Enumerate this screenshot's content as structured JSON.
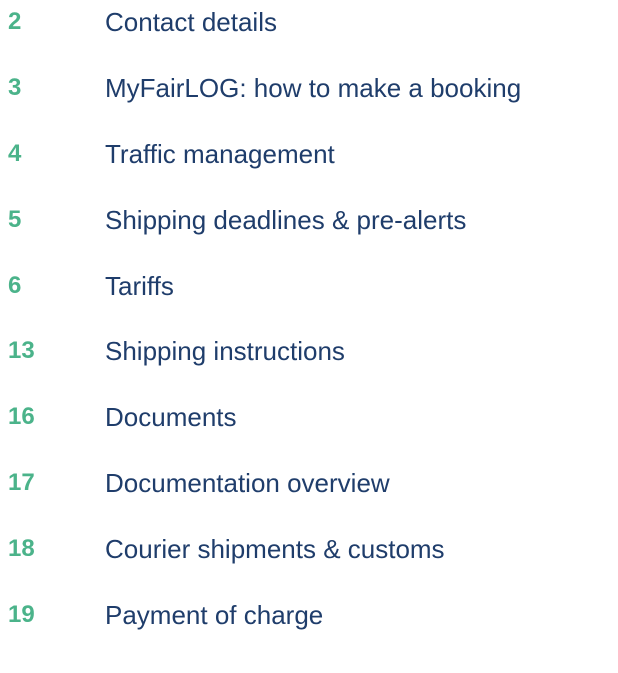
{
  "toc": {
    "entries": [
      {
        "page": "2",
        "label": "Contact details"
      },
      {
        "page": "3",
        "label": "MyFairLOG: how to make a booking"
      },
      {
        "page": "4",
        "label": "Traffic management"
      },
      {
        "page": "5",
        "label": "Shipping deadlines & pre-alerts"
      },
      {
        "page": "6",
        "label": "Tariffs"
      },
      {
        "page": "13",
        "label": "Shipping instructions"
      },
      {
        "page": "16",
        "label": "Documents"
      },
      {
        "page": "17",
        "label": "Documentation overview"
      },
      {
        "page": "18",
        "label": "Courier shipments & customs"
      },
      {
        "page": "19",
        "label": "Payment of charge"
      }
    ]
  },
  "colors": {
    "page_number": "#4bb38a",
    "label": "#1f3d6b",
    "background": "#ffffff"
  }
}
